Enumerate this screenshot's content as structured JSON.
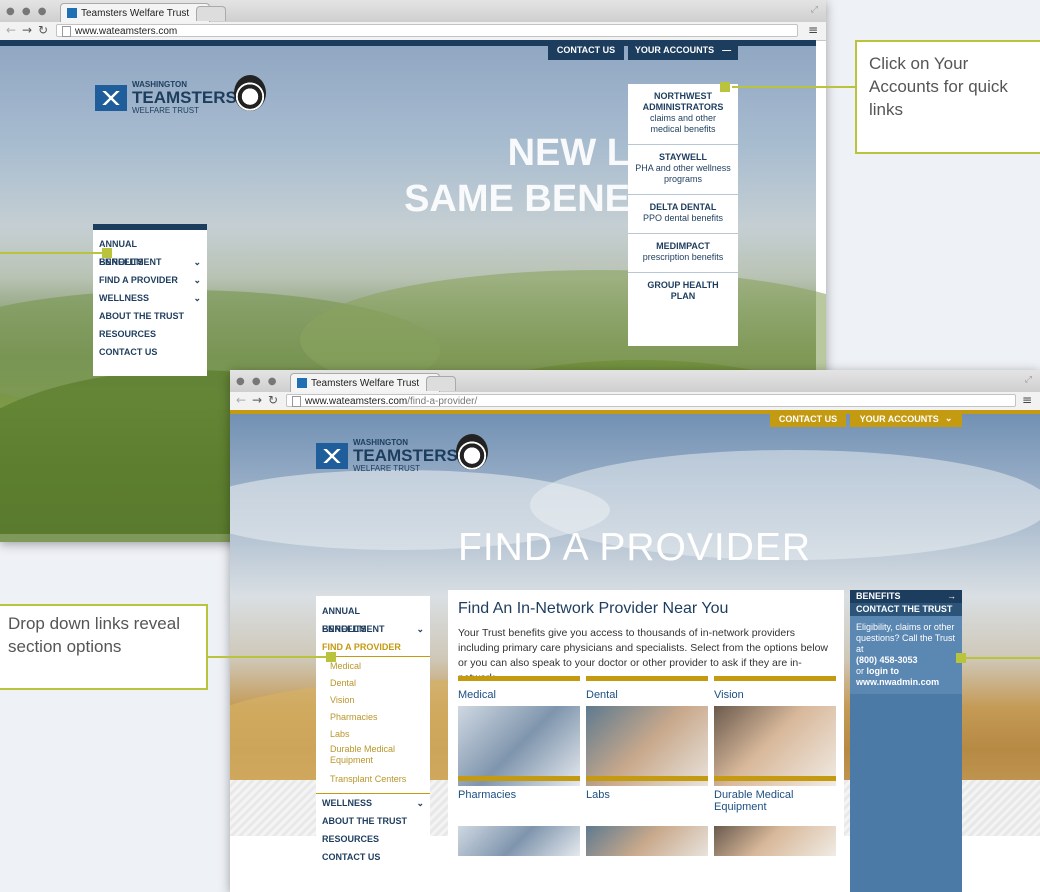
{
  "window1": {
    "tab_title": "Teamsters Welfare Trust",
    "tab_close": "×",
    "url": "www.wateamsters.com",
    "nav": {
      "contact": "CONTACT US",
      "accounts": "YOUR ACCOUNTS",
      "accounts_toggle": "—"
    },
    "logo": {
      "line1": "WASHINGTON",
      "line2": "TEAMSTERS",
      "line3": "WELFARE TRUST"
    },
    "hero_line1": "NEW L",
    "hero_line2": "SAME BENE",
    "sidenav": [
      {
        "label": "ANNUAL ENROLLMENT",
        "chevron": ""
      },
      {
        "label": "BENEFITS",
        "chevron": "⌄"
      },
      {
        "label": "FIND A PROVIDER",
        "chevron": "⌄"
      },
      {
        "label": "WELLNESS",
        "chevron": "⌄"
      },
      {
        "label": "ABOUT THE TRUST",
        "chevron": ""
      },
      {
        "label": "RESOURCES",
        "chevron": ""
      },
      {
        "label": "CONTACT US",
        "chevron": ""
      }
    ],
    "accounts_dropdown": [
      {
        "title": "NORTHWEST ADMINISTRATORS",
        "desc": "claims and other medical benefits"
      },
      {
        "title": "STAYWELL",
        "desc": "PHA and other wellness programs"
      },
      {
        "title": "DELTA DENTAL",
        "desc": "PPO dental benefits"
      },
      {
        "title": "MEDIMPACT",
        "desc": "prescription benefits"
      },
      {
        "title": "GROUP HEALTH PLAN",
        "desc": ""
      }
    ]
  },
  "window2": {
    "tab_title": "Teamsters Welfare Trust",
    "tab_close": "×",
    "url_host": "www.wateamsters.com",
    "url_path": "/find-a-provider/",
    "nav": {
      "contact": "CONTACT US",
      "accounts": "YOUR ACCOUNTS",
      "accounts_toggle": "⌄"
    },
    "logo": {
      "line1": "WASHINGTON",
      "line2": "TEAMSTERS",
      "line3": "WELFARE TRUST"
    },
    "page_title": "FIND A PROVIDER",
    "sidenav": [
      {
        "label": "ANNUAL ENROLLMENT",
        "type": "top",
        "chevron": ""
      },
      {
        "label": "BENEFITS",
        "type": "top",
        "chevron": "⌄"
      },
      {
        "label": "FIND A PROVIDER",
        "type": "active",
        "chevron": ""
      },
      {
        "label": "Medical",
        "type": "sub",
        "chevron": ""
      },
      {
        "label": "Dental",
        "type": "sub",
        "chevron": ""
      },
      {
        "label": "Vision",
        "type": "sub",
        "chevron": ""
      },
      {
        "label": "Pharmacies",
        "type": "sub",
        "chevron": ""
      },
      {
        "label": "Labs",
        "type": "sub",
        "chevron": ""
      },
      {
        "label": "Durable Medical Equipment",
        "type": "sub2",
        "chevron": ""
      },
      {
        "label": "Transplant Centers",
        "type": "sub",
        "chevron": ""
      },
      {
        "label": "WELLNESS",
        "type": "top",
        "chevron": "⌄"
      },
      {
        "label": "ABOUT THE TRUST",
        "type": "top",
        "chevron": ""
      },
      {
        "label": "RESOURCES",
        "type": "top",
        "chevron": ""
      },
      {
        "label": "CONTACT US",
        "type": "top",
        "chevron": ""
      }
    ],
    "heading": "Find An In-Network Provider Near You",
    "intro": "Your Trust benefits give you access to thousands of in-network providers including primary care physicians and specialists. Select from the options below or you can also speak to your doctor or other provider to ask if they are in-network.",
    "categories": [
      "Medical",
      "Dental",
      "Vision",
      "Pharmacies",
      "Labs",
      "Durable Medical Equipment"
    ],
    "right": {
      "benefits": "BENEFITS",
      "benefits_arrow": "→",
      "contact_head": "CONTACT THE TRUST",
      "contact_text": "Eligibility, claims or other questions? Call the Trust at",
      "phone": "(800) 458-3053",
      "or": "or",
      "login": "login to",
      "site": "www.nwadmin.com"
    }
  },
  "callouts": {
    "accounts": "Click on Your Accounts for quick links",
    "dropdown": "Drop down links reveal section options"
  },
  "colors": {
    "navy": "#1d3d5e",
    "gold": "#c49a10",
    "lime": "#b9c43c",
    "blue": "#4c7aa7"
  }
}
